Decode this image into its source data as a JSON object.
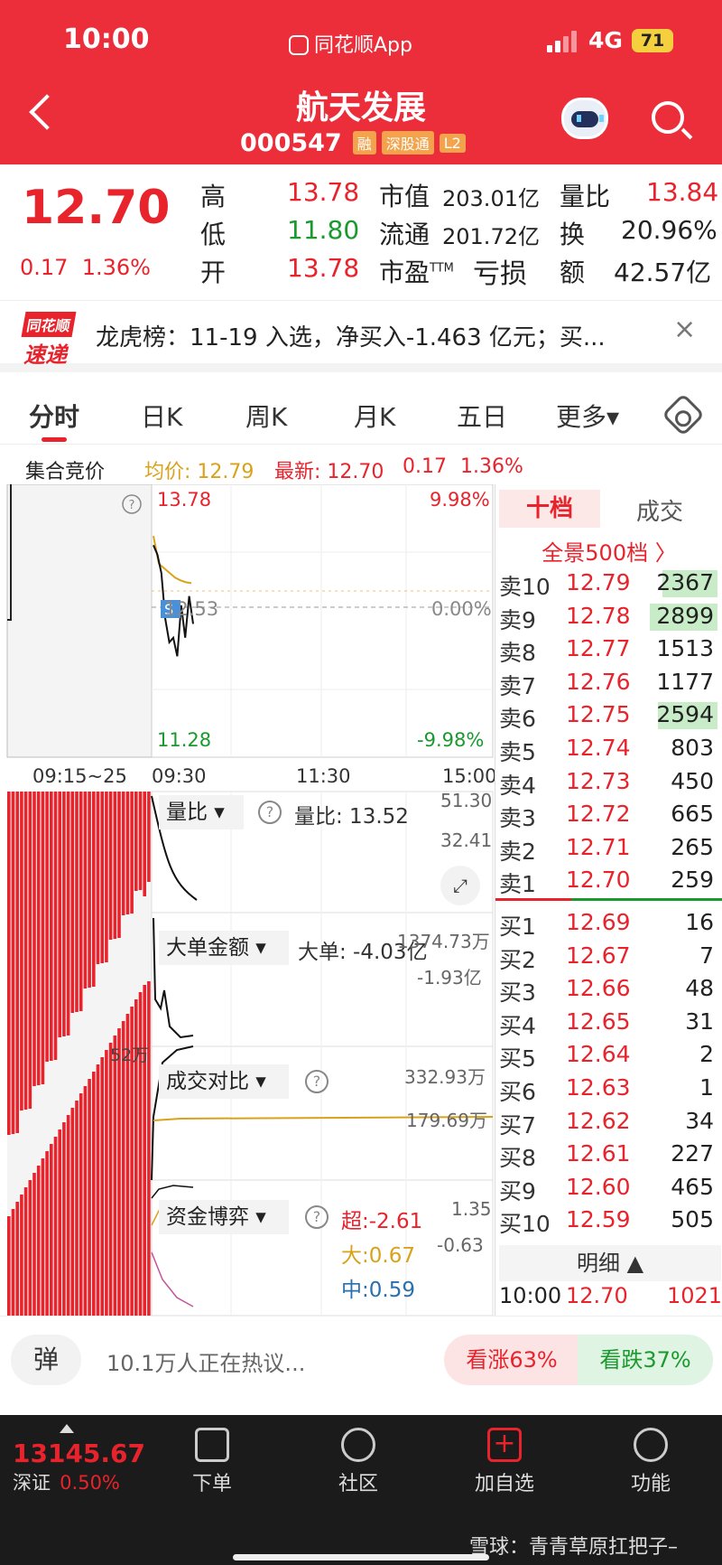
{
  "status": {
    "time": "10:00",
    "app": "同花顺App",
    "network": "4G",
    "battery": "71"
  },
  "header": {
    "name": "航天发展",
    "code": "000547",
    "tags": [
      "融",
      "深股通",
      "L2"
    ]
  },
  "quote": {
    "price": "12.70",
    "change": "0.17",
    "change_pct": "1.36%",
    "high_label": "高",
    "high": "13.78",
    "low_label": "低",
    "low": "11.80",
    "open_label": "开",
    "open": "13.78",
    "mcap_label": "市值",
    "mcap": "203.01亿",
    "float_label": "流通",
    "float": "201.72亿",
    "pe_label": "市盈",
    "pe_sup": "TTM",
    "pe": "亏损",
    "vr_label": "量比",
    "vr": "13.84",
    "turn_label": "换",
    "turn": "20.96%",
    "amt_label": "额",
    "amt": "42.57亿"
  },
  "banner": {
    "logo_top": "同花顺",
    "logo_bottom": "速递",
    "text": "龙虎榜：11-19 入选，净买入-1.463 亿元；买...",
    "close": "×"
  },
  "tabs": [
    "分时",
    "日K",
    "周K",
    "月K",
    "五日",
    "更多▾"
  ],
  "info": {
    "auction": "集合竞价",
    "avg": "均价: 12.79",
    "latest_label": "最新: 12.70",
    "chg": "0.17",
    "pct": "1.36%"
  },
  "chart": {
    "top_price": "13.78",
    "top_pct": "9.98%",
    "mid_price": "12.53",
    "mid_pct": "0.00%",
    "bot_price": "11.28",
    "bot_pct": "-9.98%",
    "times": [
      "09:15~25",
      "09:30",
      "11:30",
      "15:00"
    ],
    "vol_label": "52万",
    "panel1": {
      "name": "量比",
      "value": "量比: 13.52",
      "top": "51.30",
      "mid": "32.41"
    },
    "panel2": {
      "name": "大单金额",
      "value": "大单: -4.03亿",
      "top": "1374.73万",
      "mid": "-1.93亿"
    },
    "panel3": {
      "name": "成交对比",
      "top": "332.93万",
      "mid": "179.69万"
    },
    "panel4": {
      "name": "资金博弈",
      "super": "超:-2.61",
      "large": "大:0.67",
      "mid": "中:0.59",
      "top": "1.35",
      "low": "-0.63"
    },
    "series": {
      "price": [
        13.2,
        13.1,
        12.9,
        12.4,
        12.15,
        12.2,
        12.0,
        12.55,
        12.2,
        12.65,
        12.35
      ],
      "avg": [
        13.3,
        13.0,
        12.95,
        12.9,
        12.85,
        12.82,
        12.8,
        12.79
      ]
    }
  },
  "book": {
    "tab1": "十档",
    "tab2": "成交",
    "full": "全景500档 〉",
    "asks": [
      {
        "label": "卖10",
        "price": "12.79",
        "vol": "2367",
        "bar": 0.55
      },
      {
        "label": "卖9",
        "price": "12.78",
        "vol": "2899",
        "bar": 0.68
      },
      {
        "label": "卖8",
        "price": "12.77",
        "vol": "1513",
        "bar": 0
      },
      {
        "label": "卖7",
        "price": "12.76",
        "vol": "1177",
        "bar": 0
      },
      {
        "label": "卖6",
        "price": "12.75",
        "vol": "2594",
        "bar": 0.6
      },
      {
        "label": "卖5",
        "price": "12.74",
        "vol": "803",
        "bar": 0
      },
      {
        "label": "卖4",
        "price": "12.73",
        "vol": "450",
        "bar": 0
      },
      {
        "label": "卖3",
        "price": "12.72",
        "vol": "665",
        "bar": 0
      },
      {
        "label": "卖2",
        "price": "12.71",
        "vol": "265",
        "bar": 0
      },
      {
        "label": "卖1",
        "price": "12.70",
        "vol": "259",
        "bar": 0
      }
    ],
    "bids": [
      {
        "label": "买1",
        "price": "12.69",
        "vol": "16"
      },
      {
        "label": "买2",
        "price": "12.67",
        "vol": "7"
      },
      {
        "label": "买3",
        "price": "12.66",
        "vol": "48"
      },
      {
        "label": "买4",
        "price": "12.65",
        "vol": "31"
      },
      {
        "label": "买5",
        "price": "12.64",
        "vol": "2"
      },
      {
        "label": "买6",
        "price": "12.63",
        "vol": "1"
      },
      {
        "label": "买7",
        "price": "12.62",
        "vol": "34"
      },
      {
        "label": "买8",
        "price": "12.61",
        "vol": "227"
      },
      {
        "label": "买9",
        "price": "12.60",
        "vol": "465"
      },
      {
        "label": "买10",
        "price": "12.59",
        "vol": "505"
      }
    ],
    "detail_label": "明细 ▲",
    "detail": {
      "time": "10:00",
      "price": "12.70",
      "vol": "1021"
    }
  },
  "comment": {
    "danmu": "弹",
    "placeholder": "10.1万人正在热议...",
    "bull": "看涨63%",
    "bear": "看跌37%"
  },
  "nav": {
    "index_value": "13145.67",
    "index_name": "深证",
    "index_pct": "0.50%",
    "items": [
      "下单",
      "社区",
      "加自选",
      "功能"
    ],
    "watermark": "雪球：青青草原扛把子–"
  }
}
